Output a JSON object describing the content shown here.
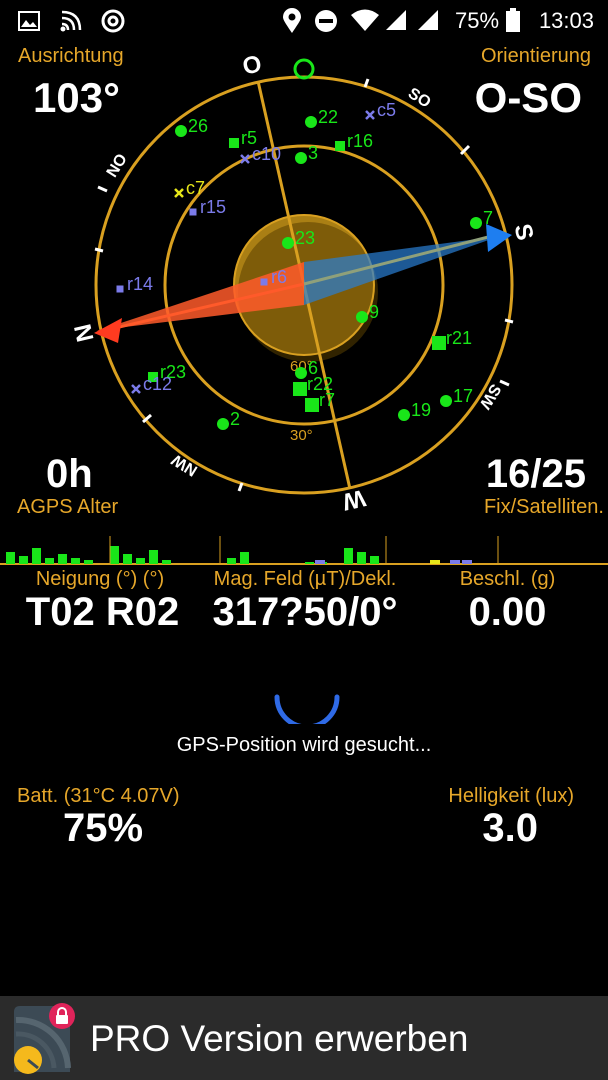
{
  "status_bar": {
    "icons": [
      "image-icon",
      "wifi-calling-icon",
      "at-sign-icon",
      "location-pin-icon",
      "do-not-disturb-icon",
      "wifi-icon",
      "signal-icon",
      "signal-icon",
      "battery-icon"
    ],
    "battery": "75%",
    "time": "13:03"
  },
  "heading": {
    "label": "Ausrichtung",
    "value": "103°"
  },
  "orientation": {
    "label": "Orientierung",
    "value": "O-SO"
  },
  "agps": {
    "value": "0h",
    "label": "AGPS Alter"
  },
  "fix": {
    "value": "16/25",
    "label": "Fix/Satelliten."
  },
  "compass": {
    "cardinals": {
      "east": "O",
      "south": "S",
      "west": "W",
      "north": "N"
    },
    "intercardinals": {
      "se": "SO",
      "sw": "SW",
      "nw": "NW",
      "ne": "NO"
    },
    "ring_labels": {
      "r30": "30°",
      "r60": "60°"
    },
    "satellites": [
      {
        "id": "sat-26",
        "label": "26",
        "shape": "circle",
        "color": "#19e619"
      },
      {
        "id": "sat-r5",
        "label": "r5",
        "shape": "square",
        "color": "#19e619"
      },
      {
        "id": "sat-22",
        "label": "22",
        "shape": "circle",
        "color": "#19e619"
      },
      {
        "id": "sat-c5",
        "label": "c5",
        "shape": "cross",
        "color": "#7b7bea"
      },
      {
        "id": "sat-c10",
        "label": "c10",
        "shape": "cross",
        "color": "#7b7bea"
      },
      {
        "id": "sat-3",
        "label": "3",
        "shape": "circle",
        "color": "#19e619"
      },
      {
        "id": "sat-r16",
        "label": "r16",
        "shape": "square",
        "color": "#19e619"
      },
      {
        "id": "sat-c7",
        "label": "c7",
        "shape": "cross",
        "color": "#e6e619"
      },
      {
        "id": "sat-r15",
        "label": "r15",
        "shape": "square",
        "color": "#7b7bea"
      },
      {
        "id": "sat-7",
        "label": "7",
        "shape": "circle",
        "color": "#19e619"
      },
      {
        "id": "sat-23",
        "label": "23",
        "shape": "circle",
        "color": "#19e619"
      },
      {
        "id": "sat-r14",
        "label": "r14",
        "shape": "square",
        "color": "#7b7bea"
      },
      {
        "id": "sat-r6",
        "label": "r6",
        "shape": "square",
        "color": "#7b7bea"
      },
      {
        "id": "sat-9",
        "label": "9",
        "shape": "circle",
        "color": "#19e619"
      },
      {
        "id": "sat-r21",
        "label": "r21",
        "shape": "square",
        "color": "#19e619"
      },
      {
        "id": "sat-r23",
        "label": "r23",
        "shape": "square",
        "color": "#19e619"
      },
      {
        "id": "sat-c12",
        "label": "c12",
        "shape": "cross",
        "color": "#7b7bea"
      },
      {
        "id": "sat-6",
        "label": "6",
        "shape": "circle",
        "color": "#19e619"
      },
      {
        "id": "sat-r22",
        "label": "r22",
        "shape": "square",
        "color": "#19e619"
      },
      {
        "id": "sat-r7",
        "label": "r7",
        "shape": "square",
        "color": "#19e619"
      },
      {
        "id": "sat-19",
        "label": "19",
        "shape": "circle",
        "color": "#19e619"
      },
      {
        "id": "sat-17",
        "label": "17",
        "shape": "circle",
        "color": "#19e619"
      },
      {
        "id": "sat-2",
        "label": "2",
        "shape": "circle",
        "color": "#19e619"
      }
    ]
  },
  "signal_bars": {
    "green_levels": [
      0.6,
      0.4,
      0.8,
      0.3,
      0.5,
      0.3,
      0.2,
      0.0,
      0.9,
      0.5,
      0.3,
      0.7,
      0.2,
      0.0,
      0.0,
      0.0,
      0.0,
      0.3,
      0.6,
      0.0,
      0.0,
      0.0,
      0.0,
      0.1,
      0.1,
      0.0,
      0.8,
      0.6,
      0.4,
      0.0,
      0.0,
      0.0,
      0.0,
      0.0,
      0.0,
      0.0,
      0.0,
      0.0
    ]
  },
  "sensors": [
    {
      "label": "Neigung (°) (°)",
      "value": "T02 R02"
    },
    {
      "label": "Mag. Feld (µT)/Dekl.",
      "value": "317?50/0°"
    },
    {
      "label": "Beschl. (g)",
      "value": "0.00"
    }
  ],
  "gps_status": "GPS-Position wird gesucht...",
  "battery": {
    "label": "Batt. (31°C 4.07V)",
    "value": "75%"
  },
  "brightness": {
    "label": "Helligkeit (lux)",
    "value": "3.0"
  },
  "promo": {
    "label": "PRO Version erwerben"
  },
  "colors": {
    "gold": "#e6a72a",
    "green": "#19e619",
    "blue": "#7b7bea",
    "background": "#000000",
    "promo_bar": "#2b2b2b"
  }
}
